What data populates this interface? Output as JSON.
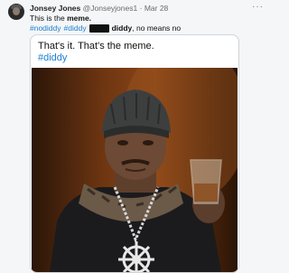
{
  "tweet": {
    "author_name": "Jonsey Jones",
    "author_handle": "@Jonseyjones1",
    "separator": "·",
    "date": "Mar 28",
    "more_label": "···",
    "line1_prefix": "This is the ",
    "line1_bold": "meme.",
    "hashtag1": "#nodiddy",
    "hashtag2": "#diddy",
    "line2_bold": "diddy",
    "line2_rest": ", no means no"
  },
  "card": {
    "text": "That's it. That's the meme.",
    "hashtag": "#diddy"
  },
  "colors": {
    "link": "#1d7fd1",
    "background": "#f4f6f7"
  },
  "icons": {
    "avatar": "profile-photo",
    "more": "more-horizontal-icon"
  }
}
